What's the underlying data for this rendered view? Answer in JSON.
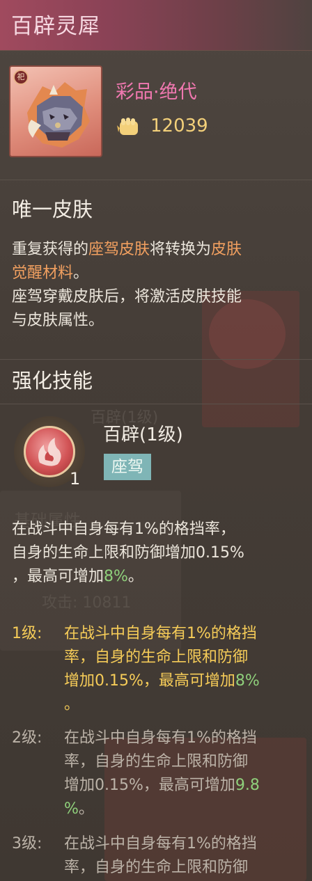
{
  "header": {
    "title": "百辟灵犀"
  },
  "item": {
    "quality": "彩品·绝代",
    "power": "12039",
    "badge": "祀",
    "icon": "rhino-mask-icon"
  },
  "skin_section": {
    "title": "唯一皮肤",
    "line1_a": "重复获得的",
    "line1_hl": "座驾皮肤",
    "line1_b": "将转换为",
    "line1_hl2": "皮肤",
    "line2_hl": "觉醒材料",
    "line2_b": "。",
    "line3": "座驾穿戴皮肤后，将激活皮肤技能",
    "line4": "与皮肤属性。"
  },
  "skill_section": {
    "title": "强化技能",
    "skill_name": "百辟(1级)",
    "skill_level": "1",
    "skill_tag": "座驾",
    "desc_line1": "在战斗中自身每有1%的格挡率，",
    "desc_line2": "自身的生命上限和防御增加0.15%",
    "desc_line3_a": "，最高可增加",
    "desc_line3_g": "8%",
    "desc_line3_b": "。"
  },
  "levels": [
    {
      "label": "1级:",
      "l1": "在战斗中自身每有1%的格挡",
      "l2": "率，自身的生命上限和防御",
      "l3a": "增加0.15%，最高可增加",
      "l3g": "8%",
      "l4a": "",
      "l4g": "",
      "l4b": "。"
    },
    {
      "label": "2级:",
      "l1": "在战斗中自身每有1%的格挡",
      "l2": "率，自身的生命上限和防御",
      "l3a": "增加0.15%，最高可增加",
      "l3g": "9.8",
      "l4a": "",
      "l4g": "%",
      "l4b": "。"
    },
    {
      "label": "3级:",
      "l1": "在战斗中自身每有1%的格挡",
      "l2": "率，自身的生命上限和防御"
    }
  ],
  "background_ghost": {
    "a": "百辟(1级)",
    "b": "座驾",
    "c": "基础属性",
    "d": "攻击: 10811"
  },
  "colors": {
    "title_bar": "#a04a5e",
    "quality": "#f078b0",
    "power": "#f3d07a",
    "highlight": "#f2a060",
    "green": "#8fd07b",
    "active_level": "#f6cc58",
    "tag_bg": "#7fb5b6"
  }
}
